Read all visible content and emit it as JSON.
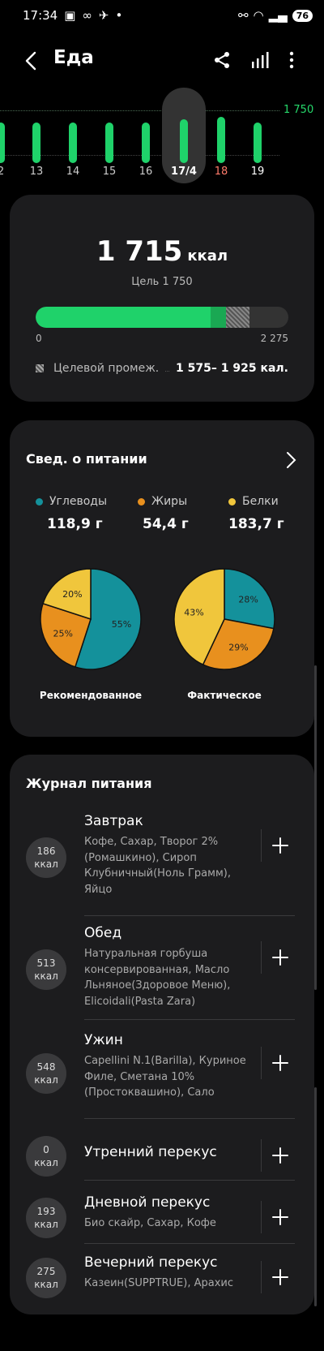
{
  "status": {
    "time": "17:34",
    "battery": "76"
  },
  "header": {
    "title": "Еда"
  },
  "day_chart": {
    "goal_label": "1 750",
    "days": [
      {
        "label": "2",
        "fraction": 0.62,
        "selected": false,
        "color": "#cccccc"
      },
      {
        "label": "13",
        "fraction": 0.62,
        "selected": false,
        "color": "#cccccc"
      },
      {
        "label": "14",
        "fraction": 0.62,
        "selected": false,
        "color": "#cccccc"
      },
      {
        "label": "15",
        "fraction": 0.62,
        "selected": false,
        "color": "#cccccc"
      },
      {
        "label": "16",
        "fraction": 0.62,
        "selected": false,
        "color": "#cccccc"
      },
      {
        "label": "17/4",
        "fraction": 0.67,
        "selected": true,
        "color": "#ffffff"
      },
      {
        "label": "18",
        "fraction": 0.71,
        "selected": false,
        "color": "#ff7b6b"
      },
      {
        "label": "19",
        "fraction": 0.62,
        "selected": false,
        "color": "#ffffff"
      }
    ]
  },
  "summary": {
    "kcal": "1 715",
    "unit": "ккал",
    "goal": "Цель 1 750",
    "min": "0",
    "max": "2 275",
    "progress_fraction": 0.754,
    "target_label": "Целевой промеж.",
    "target_value": "1 575– 1 925 кал."
  },
  "nutrition": {
    "title": "Свед. о питании",
    "carbs": {
      "label": "Углеводы",
      "value": "118,9 г",
      "color": "#14919b"
    },
    "fats": {
      "label": "Жиры",
      "value": "54,4 г",
      "color": "#e8901e"
    },
    "proteins": {
      "label": "Белки",
      "value": "183,7 г",
      "color": "#f0c63c"
    },
    "recommended": {
      "caption": "Рекомендованное",
      "carbs": 55,
      "fats": 25,
      "proteins": 20,
      "carbs_label": "55%",
      "fats_label": "25%",
      "proteins_label": "20%"
    },
    "actual": {
      "caption": "Фактическое",
      "carbs": 28,
      "fats": 29,
      "proteins": 43,
      "carbs_label": "28%",
      "fats_label": "29%",
      "proteins_label": "43%"
    }
  },
  "journal": {
    "title": "Журнал питания",
    "unit": "ккал",
    "entries": [
      {
        "kcal": "186",
        "name": "Завтрак",
        "desc": "Кофе, Сахар, Творог 2% (Ромашкино), Сироп Клубничный(Ноль Грамм), Яйцо"
      },
      {
        "kcal": "513",
        "name": "Обед",
        "desc": "Натуральная горбуша консервированная, Масло Льняное(Здоровое Меню), Elicoidali(Pasta Zara)"
      },
      {
        "kcal": "548",
        "name": "Ужин",
        "desc": "Capellini N.1(Barilla), Куриное Филе, Сметана 10% (Простоквашино), Сало"
      },
      {
        "kcal": "0",
        "name": "Утренний перекус",
        "desc": ""
      },
      {
        "kcal": "193",
        "name": "Дневной перекус",
        "desc": "Био скайр, Сахар, Кофе"
      },
      {
        "kcal": "275",
        "name": "Вечерний перекус",
        "desc": "Казеин(SUPPTRUE), Арахис"
      }
    ]
  }
}
